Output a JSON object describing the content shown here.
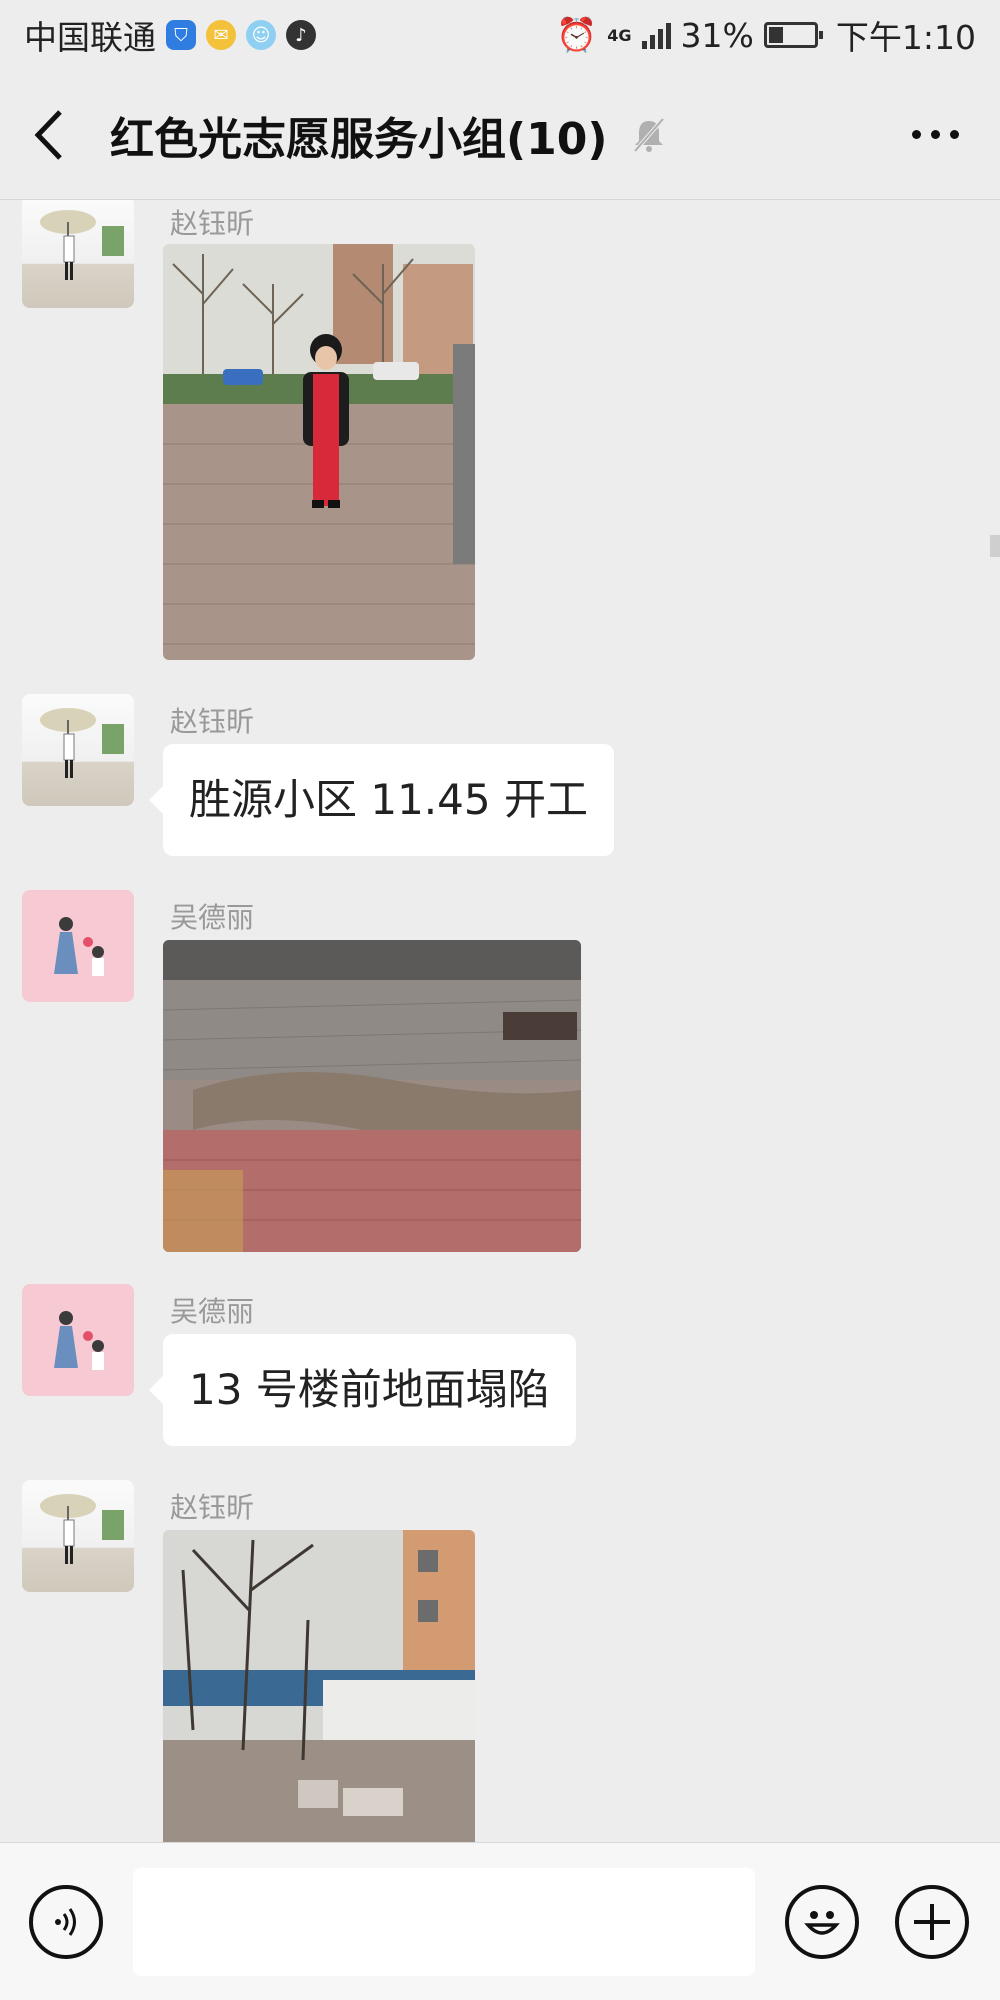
{
  "status_bar": {
    "carrier": "中国联通",
    "network": "4G",
    "battery": "31%",
    "time": "下午1:10",
    "notification_icons": [
      "shield-icon",
      "mail-icon",
      "qq-icon",
      "tiktok-icon"
    ]
  },
  "header": {
    "title": "红色光志愿服务小组(10)",
    "muted": true
  },
  "messages": [
    {
      "sender": "赵钰昕",
      "type": "image",
      "image": "child-standing-on-brick-path"
    },
    {
      "sender": "赵钰昕",
      "type": "text",
      "text": "胜源小区 11.45 开工"
    },
    {
      "sender": "吴德丽",
      "type": "image",
      "image": "damaged-brick-pavement"
    },
    {
      "sender": "吴德丽",
      "type": "text",
      "text": "13 号楼前地面塌陷"
    },
    {
      "sender": "赵钰昕",
      "type": "image",
      "image": "courtyard-with-bare-trees"
    }
  ],
  "input": {
    "value": "",
    "placeholder": ""
  },
  "colors": {
    "background": "#ededed",
    "bubble": "#ffffff",
    "sender_name": "#999999"
  }
}
